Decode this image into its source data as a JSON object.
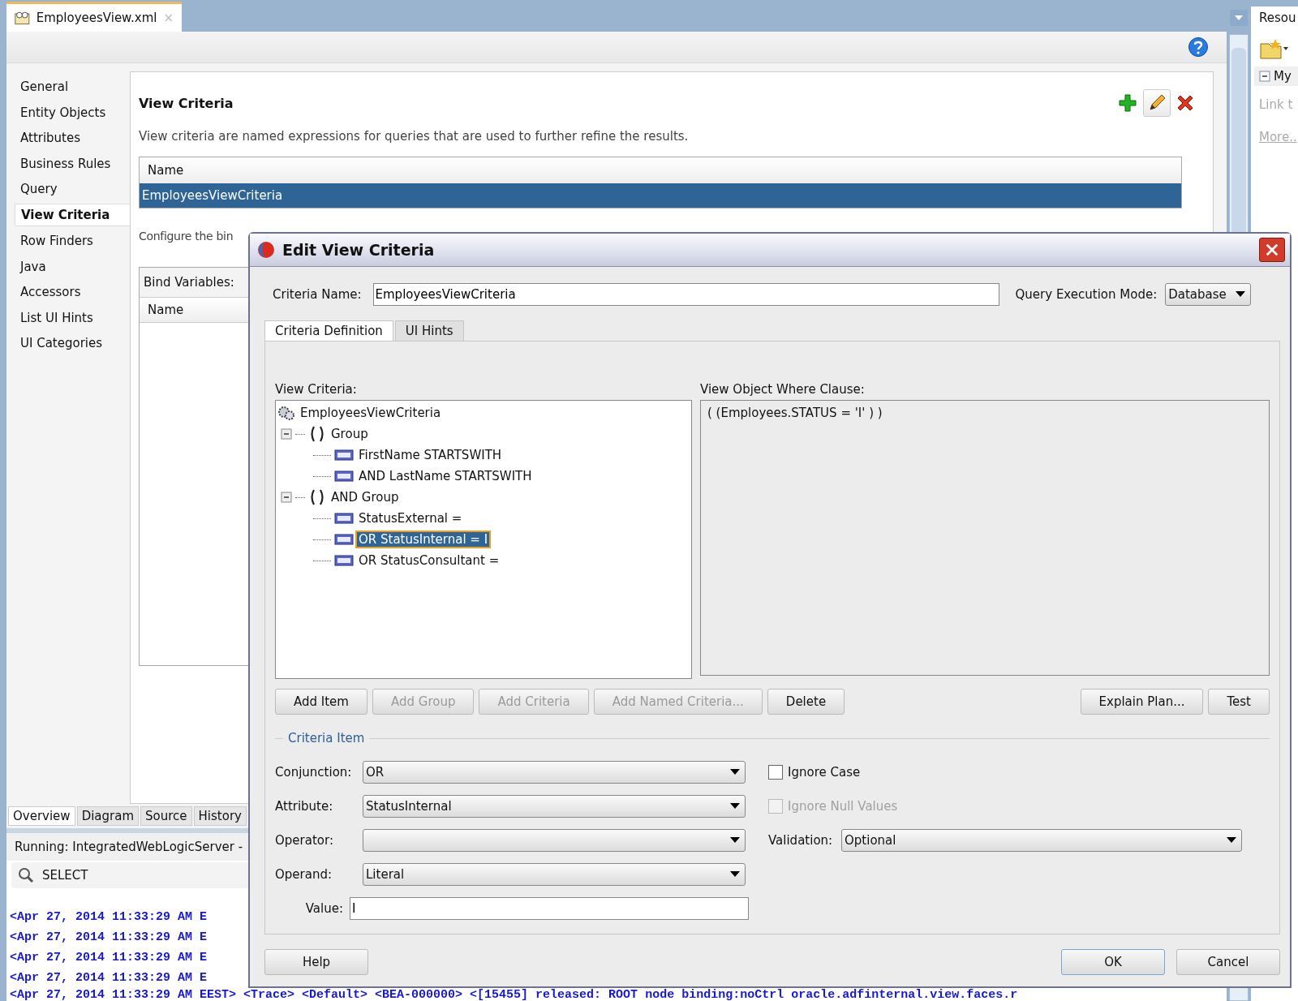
{
  "editor_tab": {
    "title": "EmployeesView.xml",
    "close": "×"
  },
  "nav": [
    {
      "label": "General",
      "selected": false
    },
    {
      "label": "Entity Objects",
      "selected": false
    },
    {
      "label": "Attributes",
      "selected": false
    },
    {
      "label": "Business Rules",
      "selected": false
    },
    {
      "label": "Query",
      "selected": false
    },
    {
      "label": "View Criteria",
      "selected": true
    },
    {
      "label": "Row Finders",
      "selected": false
    },
    {
      "label": "Java",
      "selected": false
    },
    {
      "label": "Accessors",
      "selected": false
    },
    {
      "label": "List UI Hints",
      "selected": false
    },
    {
      "label": "UI Categories",
      "selected": false
    }
  ],
  "section": {
    "title": "View Criteria",
    "description": "View criteria are named expressions for queries that are used to further refine the results.",
    "table": {
      "column": "Name",
      "rows": [
        {
          "name": "EmployeesViewCriteria",
          "selected": true
        }
      ]
    },
    "configure_text": "Configure the bin",
    "bind_variables": {
      "label": "Bind Variables:",
      "column": "Name"
    }
  },
  "bottom_tabs": [
    {
      "label": "Overview",
      "selected": true
    },
    {
      "label": "Diagram",
      "selected": false
    },
    {
      "label": "Source",
      "selected": false
    },
    {
      "label": "History",
      "selected": false
    }
  ],
  "log": {
    "title": "Running: IntegratedWebLogicServer -",
    "search": "SELECT",
    "lines": [
      "<Apr 27, 2014 11:33:29 AM E",
      "<Apr 27, 2014 11:33:29 AM E",
      "<Apr 27, 2014 11:33:29 AM E",
      "<Apr 27, 2014 11:33:29 AM E",
      "<Apr 27, 2014 11:33:29 AM EEST> <Trace> <Default> <BEA-000000> <[15455] released: ROOT node binding:noCtrl oracle.adfinternal.view.faces.r"
    ]
  },
  "side_panel": {
    "title": "Resou",
    "section": "My",
    "link": "Link t",
    "more": "More.."
  },
  "dialog": {
    "title": "Edit View Criteria",
    "criteria_name_label": "Criteria Name:",
    "criteria_name": "EmployeesViewCriteria",
    "mode_label": "Query Execution Mode:",
    "mode": "Database",
    "tabs": [
      {
        "label": "Criteria Definition",
        "selected": true
      },
      {
        "label": "UI Hints",
        "selected": false
      }
    ],
    "tree_label": "View Criteria:",
    "tree": {
      "label": "EmployeesViewCriteria",
      "children": [
        {
          "kind": "group",
          "label": "Group",
          "expanded": true,
          "children": [
            {
              "kind": "item",
              "label": "FirstName STARTSWITH",
              "selected": false
            },
            {
              "kind": "item",
              "label": "AND LastName STARTSWITH",
              "selected": false
            }
          ]
        },
        {
          "kind": "group",
          "label": "AND Group",
          "expanded": true,
          "children": [
            {
              "kind": "item",
              "label": "StatusExternal =",
              "selected": false
            },
            {
              "kind": "item",
              "label": "OR StatusInternal = I",
              "selected": true
            },
            {
              "kind": "item",
              "label": "OR StatusConsultant =",
              "selected": false
            }
          ]
        }
      ]
    },
    "where_label": "View Object Where Clause:",
    "where_clause": "( (Employees.STATUS = 'I' ) )",
    "left_buttons": [
      {
        "label": "Add Item",
        "disabled": false
      },
      {
        "label": "Add Group",
        "disabled": true
      },
      {
        "label": "Add Criteria",
        "disabled": true
      },
      {
        "label": "Add Named Criteria...",
        "disabled": true
      },
      {
        "label": "Delete",
        "disabled": false
      }
    ],
    "right_buttons": [
      {
        "label": "Explain Plan...",
        "disabled": false
      },
      {
        "label": "Test",
        "disabled": false
      }
    ],
    "item_section": "Criteria Item",
    "fields": [
      {
        "kind": "select",
        "label": "Conjunction:",
        "value": "OR"
      },
      {
        "kind": "select",
        "label": "Attribute:",
        "value": "StatusInternal"
      },
      {
        "kind": "select",
        "label": "Operator:"
      },
      {
        "kind": "select",
        "label": "Operand:",
        "value": "Literal"
      },
      {
        "kind": "text",
        "label": "Value:",
        "value": "I"
      }
    ],
    "options": [
      {
        "kind": "checkbox",
        "label": "Ignore Case",
        "checked": false,
        "disabled": false
      },
      {
        "kind": "checkbox",
        "label": "Ignore Null Values",
        "checked": false,
        "disabled": true
      },
      {
        "kind": "select",
        "label": "Validation:",
        "value": "Optional"
      }
    ],
    "footer_buttons": [
      {
        "label": "Help",
        "default": false
      },
      {
        "label": "OK",
        "default": true
      },
      {
        "label": "Cancel",
        "default": false
      }
    ]
  }
}
